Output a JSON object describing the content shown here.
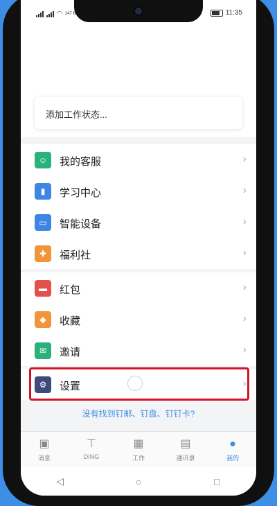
{
  "status_bar": {
    "time": "11:35",
    "net_speed": "247 B/s"
  },
  "status_card": {
    "placeholder": "添加工作状态..."
  },
  "menu_group_1": [
    {
      "label": "我的客服",
      "icon": "customer-service-icon",
      "color": "#2bb27b"
    },
    {
      "label": "学习中心",
      "icon": "book-icon",
      "color": "#3d86e3"
    },
    {
      "label": "智能设备",
      "icon": "device-icon",
      "color": "#3d86e3"
    },
    {
      "label": "福利社",
      "icon": "gift-icon",
      "color": "#f0953a"
    }
  ],
  "menu_group_2": [
    {
      "label": "红包",
      "icon": "red-packet-icon",
      "color": "#e2524a"
    },
    {
      "label": "收藏",
      "icon": "favorites-icon",
      "color": "#f0953a"
    },
    {
      "label": "邀请",
      "icon": "invite-icon",
      "color": "#2bb27b"
    }
  ],
  "settings": {
    "label": "设置",
    "icon": "gear-icon",
    "color": "#3e4a7a"
  },
  "not_found_link": "没有找到钉邮、钉盘、钉钉卡?",
  "tabs": [
    {
      "label": "消息",
      "icon": "message-icon"
    },
    {
      "label": "DING",
      "icon": "pin-icon"
    },
    {
      "label": "工作",
      "icon": "grid-icon"
    },
    {
      "label": "通讯录",
      "icon": "contacts-icon"
    },
    {
      "label": "我的",
      "icon": "person-icon",
      "active": true
    }
  ],
  "colors": {
    "accent": "#3f8ee6",
    "highlight": "#d11428"
  }
}
